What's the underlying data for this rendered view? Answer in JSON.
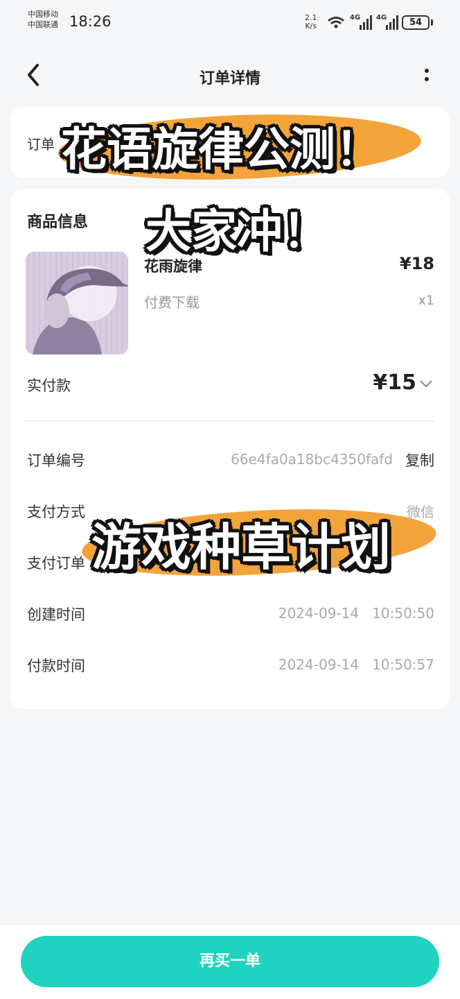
{
  "status_bar": {
    "carrier1": "中国移动",
    "carrier2": "中国联通",
    "time": "18:26",
    "net_speed_value": "2.1",
    "net_speed_unit": "K/s",
    "signal1_label": "4G",
    "signal2_label": "4G",
    "battery": "54"
  },
  "nav": {
    "title": "订单详情",
    "back_icon": "chevron-left-icon",
    "more_icon": "vertical-dots-icon"
  },
  "order_card": {
    "label_partial": "订单"
  },
  "product": {
    "section_title": "商品信息",
    "name": "花雨旋律",
    "price": "¥18",
    "type": "付费下载",
    "quantity": "x1"
  },
  "payment": {
    "paid_label": "实付款",
    "paid_value": "¥15"
  },
  "details": {
    "order_no_label": "订单编号",
    "order_no_value": "66e4fa0a18bc4350fafd",
    "copy_label": "复制",
    "pay_method_label": "支付方式",
    "pay_method_value": "微信",
    "pay_order_label": "支付订单",
    "created_label": "创建时间",
    "created_value": "2024-09-14   10:50:50",
    "paid_time_label": "付款时间",
    "paid_time_value": "2024-09-14   10:50:57"
  },
  "overlay": {
    "line1": "花语旋律公测！",
    "line2": "大家冲！",
    "line3": "游戏种草计划",
    "blob_color": "#f2a33a"
  },
  "bottom": {
    "buy_again_label": "再买一单",
    "button_color": "#1fd3c0"
  }
}
